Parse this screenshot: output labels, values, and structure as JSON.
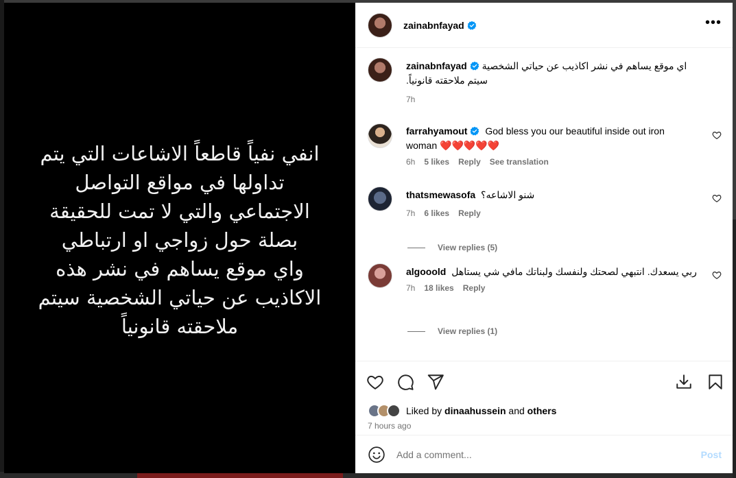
{
  "post": {
    "username": "zainabnfayad",
    "story_text": "انفي نفياً قاطعاً الاشاعات التي يتم\nتداولها في مواقع التواصل\nالاجتماعي والتي لا تمت للحقيقة\nبصلة حول زواجي او ارتباطي\nواي موقع يساهم في نشر هذه\nالاكاذيب عن حياتي الشخصية سيتم\nملاحقته قانونياً"
  },
  "caption": {
    "username": "zainabnfayad",
    "text": "اي موقع يساهم في نشر اكاذيب عن حياتي الشخصية سيتم ملاحقته قانونياً.",
    "time": "7h"
  },
  "comments": [
    {
      "username": "farrahyamout",
      "verified": true,
      "text": "God bless you our beautiful inside out iron woman ❤️❤️❤️❤️❤️",
      "time": "6h",
      "likes": "5 likes",
      "reply": "Reply",
      "translate": "See translation"
    },
    {
      "username": "thatsmewasofa",
      "text": "شنو الاشاعه؟",
      "time": "7h",
      "likes": "6 likes",
      "reply": "Reply",
      "view_replies": "View replies (5)"
    },
    {
      "username": "algooold",
      "text": "ربي يسعدك. انتبهي لصحتك ولنفسك ولبناتك مافي شي يستاهل",
      "time": "7h",
      "likes": "18 likes",
      "reply": "Reply",
      "view_replies": "View replies (1)"
    }
  ],
  "likes": {
    "prefix": "Liked by ",
    "user": "dinaahussein",
    "middle": " and ",
    "others": "others"
  },
  "time_ago": "7 hours ago",
  "add_comment": {
    "placeholder": "Add a comment...",
    "post_label": "Post"
  },
  "colors": {
    "verified": "#0095f6",
    "muted": "#737373",
    "post_disabled": "#b3dbff",
    "heart_red": "#e0242f"
  }
}
